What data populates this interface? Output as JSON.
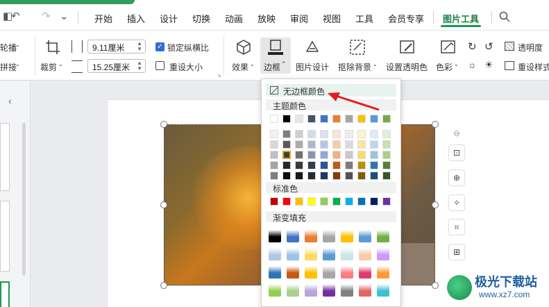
{
  "quick_access": {
    "undo": "↶",
    "redo": "↷",
    "more": "⌄"
  },
  "menu": [
    "开始",
    "插入",
    "设计",
    "切换",
    "动画",
    "放映",
    "审阅",
    "视图",
    "工具",
    "会员专享",
    "图片工具"
  ],
  "ribbon": {
    "left_cut": [
      "轮播",
      "拼接"
    ],
    "crop_label": "裁剪",
    "width_value": "9.11厘米",
    "height_value": "15.25厘米",
    "lock_ratio": "锁定纵横比",
    "reset_size": "重设大小",
    "effects": "效果",
    "border": "边框",
    "picture_design": "图片设计",
    "remove_bg": "抠除背景",
    "set_transparent": "设置透明色",
    "color": "色彩",
    "transparency": "透明度",
    "reset_style": "重设样式"
  },
  "dropdown": {
    "no_border": "无边框颜色",
    "theme_colors": "主题颜色",
    "standard_colors": "标准色",
    "gradient_fill": "渐变填充",
    "theme_top": [
      "#ffffff",
      "#000000",
      "#e7e6e6",
      "#44546a",
      "#4472c4",
      "#ed7d31",
      "#a5a5a5",
      "#ffc000",
      "#5b9bd5",
      "#70ad47"
    ],
    "theme_shades": [
      [
        "#f2f2f2",
        "#7f7f7f",
        "#d0cece",
        "#d6dce4",
        "#d9e2f3",
        "#fbe4d5",
        "#ededed",
        "#fff2cc",
        "#deebf6",
        "#e2efd9"
      ],
      [
        "#d8d8d8",
        "#595959",
        "#aeabab",
        "#adb9ca",
        "#b4c6e7",
        "#f7caac",
        "#dbdbdb",
        "#fee599",
        "#bdd7ee",
        "#c5e0b3"
      ],
      [
        "#bfbfbf",
        "#3f3f3f",
        "#757070",
        "#8496b0",
        "#8eaadb",
        "#f4b083",
        "#c9c9c9",
        "#ffd965",
        "#9cc3e5",
        "#a8d08d"
      ],
      [
        "#a5a5a5",
        "#262626",
        "#3a3838",
        "#323f4f",
        "#2f5496",
        "#c45911",
        "#7b7b7b",
        "#bf8f00",
        "#2e75b5",
        "#538135"
      ],
      [
        "#7f7f7f",
        "#0c0c0c",
        "#171616",
        "#222a35",
        "#1f3864",
        "#823b0b",
        "#525252",
        "#7f6000",
        "#1e4e79",
        "#375623"
      ]
    ],
    "standard": [
      "#c00000",
      "#ff0000",
      "#ffc000",
      "#ffff00",
      "#92d050",
      "#00b050",
      "#00b0f0",
      "#0070c0",
      "#002060",
      "#7030a0"
    ],
    "gradients": [
      [
        "#000000",
        "#4472c4",
        "#ed7d31",
        "#a5a5a5",
        "#ffc000",
        "#5b9bd5",
        "#70ad47"
      ],
      [
        "#b4c6e7",
        "#9dc3e6",
        "#ffd966",
        "#5b9bd5",
        "#c9e7e3",
        "#f8cbad",
        "#cc99ff"
      ],
      [
        "#2e75b5",
        "#c55a11",
        "#ffc000",
        "#a6a6a6",
        "#ff7c80",
        "#e03c6c",
        "#ff9933"
      ],
      [
        "#92d050",
        "#a9d18e",
        "#b4a7d6",
        "#7030a0",
        "#808080",
        "#e06666",
        "#3dc1d3"
      ]
    ]
  },
  "right_tools": [
    "⊖",
    "⊡",
    "⊕",
    "✧",
    "⌗",
    "⊞"
  ],
  "watermark": {
    "name": "极光下载站",
    "url": "www.xz7.com"
  }
}
